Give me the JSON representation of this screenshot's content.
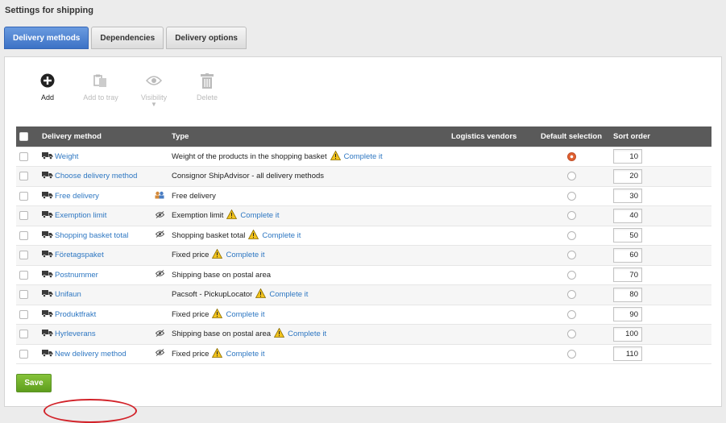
{
  "page": {
    "title": "Settings for shipping"
  },
  "tabs": [
    {
      "label": "Delivery methods",
      "active": true
    },
    {
      "label": "Dependencies",
      "active": false
    },
    {
      "label": "Delivery options",
      "active": false
    }
  ],
  "toolbar": {
    "add": {
      "label": "Add",
      "icon": "plus-circle-icon",
      "enabled": true
    },
    "add_to_tray": {
      "label": "Add to tray",
      "icon": "clipboard-icon",
      "enabled": false
    },
    "visibility": {
      "label": "Visibility",
      "icon": "eye-icon",
      "enabled": false
    },
    "delete": {
      "label": "Delete",
      "icon": "trash-icon",
      "enabled": false
    }
  },
  "table": {
    "headers": {
      "method": "Delivery method",
      "type": "Type",
      "vendors": "Logistics vendors",
      "default": "Default selection",
      "sort": "Sort order"
    },
    "rows": [
      {
        "name": "Weight",
        "col_icon": "",
        "type": "Weight of the products in the shopping basket",
        "complete": "Complete it",
        "default": true,
        "sort": "10"
      },
      {
        "name": "Choose delivery method",
        "col_icon": "",
        "type": "Consignor ShipAdvisor - all delivery methods",
        "complete": "",
        "default": false,
        "sort": "20"
      },
      {
        "name": "Free delivery",
        "col_icon": "group-icon",
        "type": "Free delivery",
        "complete": "",
        "default": false,
        "sort": "30"
      },
      {
        "name": "Exemption limit",
        "col_icon": "hidden-icon",
        "type": "Exemption limit",
        "complete": "Complete it",
        "default": false,
        "sort": "40"
      },
      {
        "name": "Shopping basket total",
        "col_icon": "hidden-icon",
        "type": "Shopping basket total",
        "complete": "Complete it",
        "default": false,
        "sort": "50"
      },
      {
        "name": "Företagspaket",
        "col_icon": "",
        "type": "Fixed price",
        "complete": "Complete it",
        "default": false,
        "sort": "60"
      },
      {
        "name": "Postnummer",
        "col_icon": "hidden-icon",
        "type": "Shipping base on postal area",
        "complete": "",
        "default": false,
        "sort": "70"
      },
      {
        "name": "Unifaun",
        "col_icon": "",
        "type": "Pacsoft - PickupLocator",
        "complete": "Complete it",
        "default": false,
        "sort": "80"
      },
      {
        "name": "Produktfrakt",
        "col_icon": "",
        "type": "Fixed price",
        "complete": "Complete it",
        "default": false,
        "sort": "90"
      },
      {
        "name": "Hyrleverans",
        "col_icon": "hidden-icon",
        "type": "Shipping base on postal area",
        "complete": "Complete it",
        "default": false,
        "sort": "100"
      },
      {
        "name": "New delivery method",
        "col_icon": "hidden-icon",
        "type": "Fixed price",
        "complete": "Complete it",
        "default": false,
        "sort": "110"
      }
    ]
  },
  "save_label": "Save",
  "colors": {
    "tab_active": "#4a80d2",
    "header_bg": "#5a5a5a",
    "link": "#2e77c2",
    "save": "#6fae2b",
    "highlight": "#d2232a",
    "warning": "#f2c31c"
  }
}
